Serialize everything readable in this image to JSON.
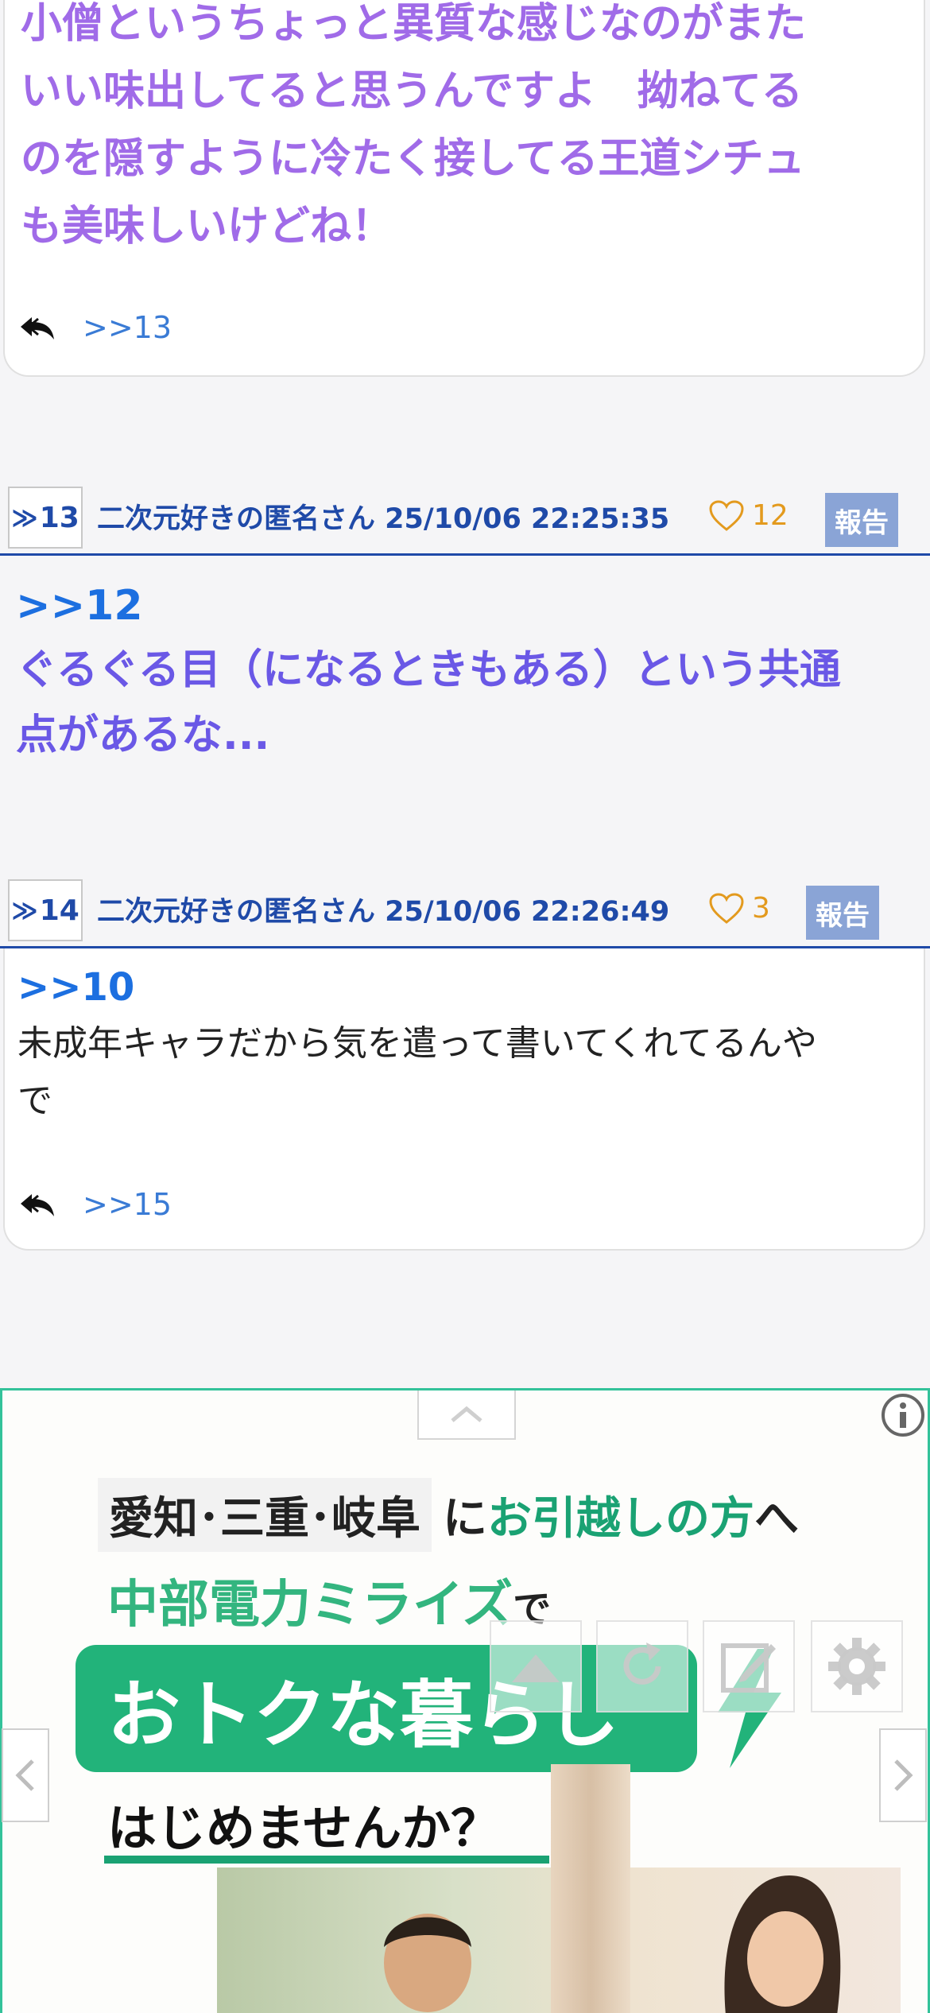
{
  "post12": {
    "lines": [
      "小僧というちょっと異質な感じなのがまた",
      "いい味出してると思うんですよ　拗ねてる",
      "のを隠すように冷たく接してる王道シチュ",
      "も美味しいけどね！"
    ],
    "reply": ">>13"
  },
  "post13": {
    "num": "13",
    "meta": "二次元好きの匿名さん 25/10/06 22:25:35",
    "likes": "12",
    "report": "報告",
    "anchor": ">>12",
    "lines": [
      "ぐるぐる目（になるときもある）という共通",
      "点があるな..."
    ]
  },
  "post14": {
    "num": "14",
    "meta": "二次元好きの匿名さん 25/10/06 22:26:49",
    "likes": "3",
    "report": "報告",
    "anchor": ">>10",
    "lines": [
      "未成年キャラだから気を遣って書いてくれてるんや",
      "で"
    ],
    "reply": ">>15"
  },
  "ad": {
    "tag": "愛知･三重･岐阜",
    "line1_a": "に",
    "line1_b": "お引越しの方",
    "line1_c": "へ",
    "line2_a": "中部電力ミライズ",
    "line2_b": "で",
    "green": "おトクな暮らし",
    "line3": "はじめませんか？"
  },
  "icons": {
    "reply": "reply-all-icon",
    "heart": "heart-icon",
    "info": "info-icon",
    "collapse": "chevron-up-icon",
    "prev": "chevron-left-icon",
    "next": "chevron-right-icon",
    "scroll_top": "scroll-top-icon",
    "reload": "reload-icon",
    "compose": "compose-icon",
    "settings": "gear-icon"
  },
  "colors": {
    "accent": "#1f4aa8",
    "like": "#e39a1e",
    "report_bg": "#8aa4d6",
    "ad_green": "#22b37a"
  }
}
